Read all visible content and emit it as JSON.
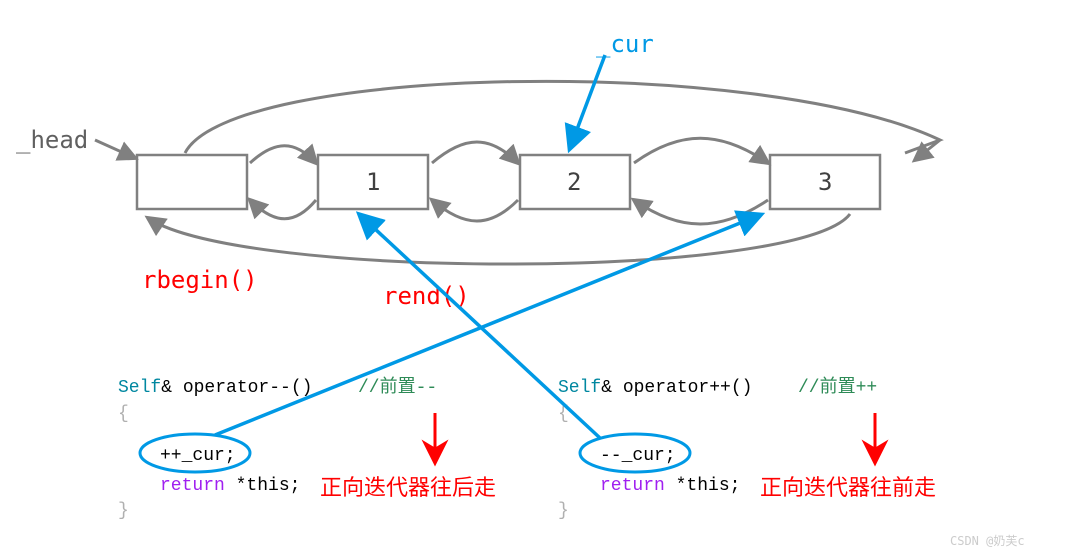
{
  "labels": {
    "head": "_head",
    "cur": "_cur",
    "rbegin": "rbegin()",
    "rend": "rend()"
  },
  "nodes": {
    "n1": "1",
    "n2": "2",
    "n3": "3"
  },
  "code_left": {
    "sig1": "Self",
    "sig2": "& operator--()",
    "comment": "//前置--",
    "body1": "++_cur;",
    "ret": "return",
    "body2": " *this;",
    "desc": "正向迭代器往后走"
  },
  "code_right": {
    "sig1": "Self",
    "sig2": "& operator++()",
    "comment": "//前置++",
    "body1": "--_cur;",
    "ret": "return",
    "body2": " *this;",
    "desc": "正向迭代器往前走"
  },
  "watermark": "CSDN @奶芙c"
}
